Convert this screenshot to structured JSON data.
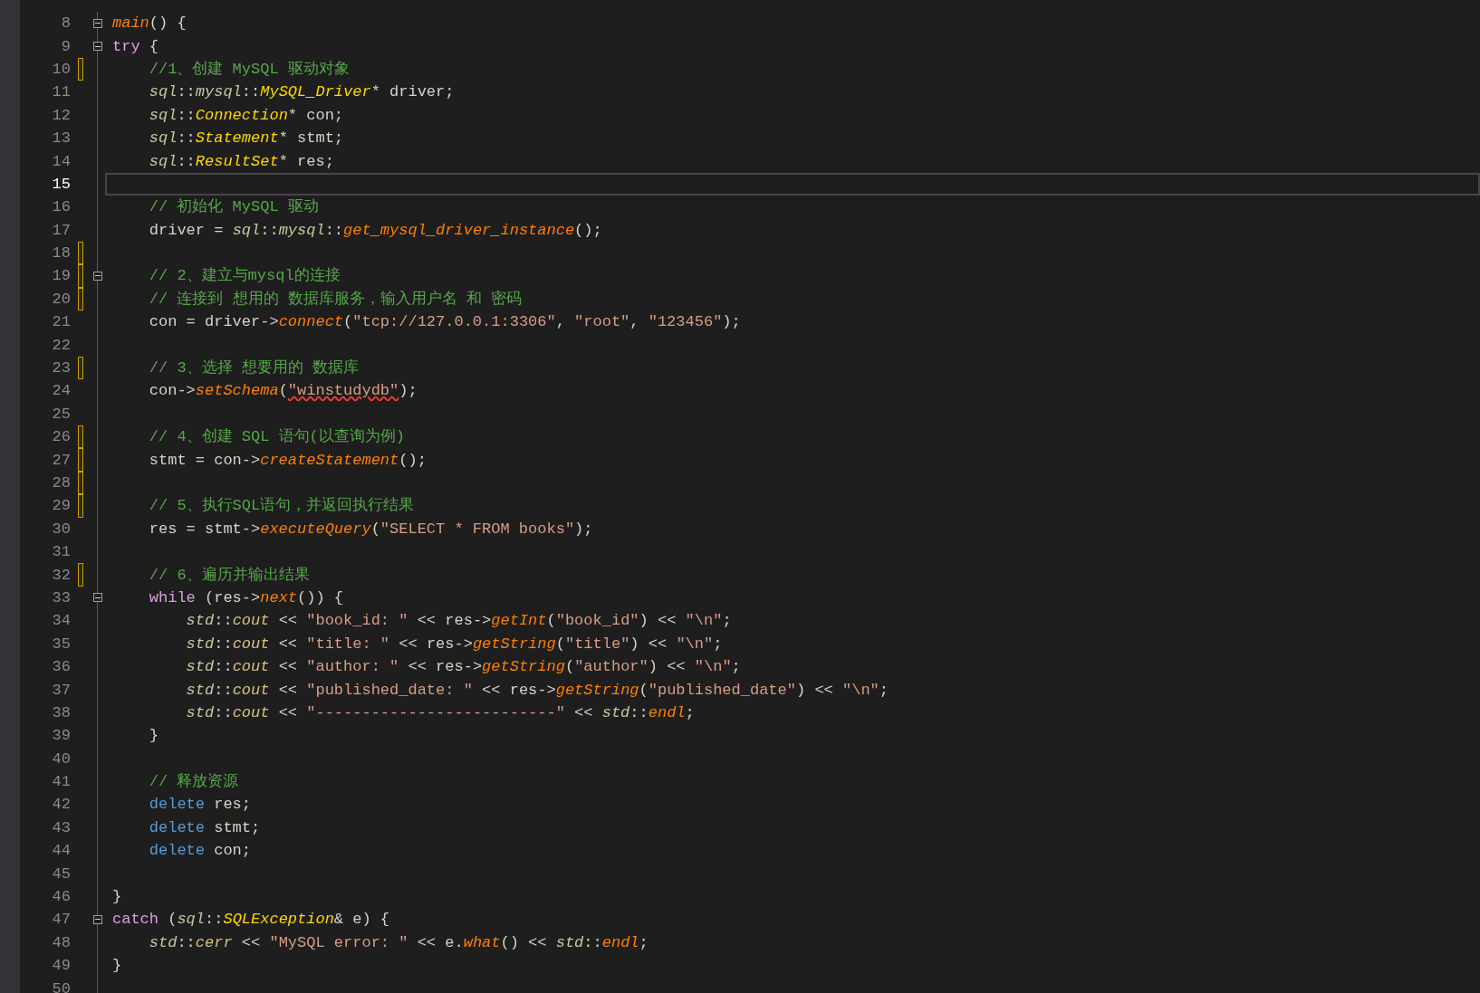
{
  "editor": {
    "lines": [
      {
        "number": "8",
        "fold": true,
        "segments": [
          {
            "kind": "fn",
            "text": "main"
          },
          {
            "kind": "p",
            "text": "() {"
          }
        ]
      },
      {
        "number": "9",
        "fold": true,
        "segments": [
          {
            "kind": "kw",
            "text": "try"
          },
          {
            "kind": "p",
            "text": " {"
          }
        ]
      },
      {
        "number": "10",
        "changed": true,
        "segments": [
          {
            "kind": "cm",
            "text": "    //1、创建 MySQL 驱动对象"
          }
        ]
      },
      {
        "number": "11",
        "segments": [
          {
            "kind": "ns",
            "text": "    sql"
          },
          {
            "kind": "p",
            "text": "::"
          },
          {
            "kind": "ns",
            "text": "mysql"
          },
          {
            "kind": "p",
            "text": "::"
          },
          {
            "kind": "ty",
            "text": "MySQL_Driver"
          },
          {
            "kind": "p",
            "text": "* driver;"
          }
        ]
      },
      {
        "number": "12",
        "segments": [
          {
            "kind": "ns",
            "text": "    sql"
          },
          {
            "kind": "p",
            "text": "::"
          },
          {
            "kind": "ty",
            "text": "Connection"
          },
          {
            "kind": "p",
            "text": "* con;"
          }
        ]
      },
      {
        "number": "13",
        "segments": [
          {
            "kind": "ns",
            "text": "    sql"
          },
          {
            "kind": "p",
            "text": "::"
          },
          {
            "kind": "ty",
            "text": "Statement"
          },
          {
            "kind": "p",
            "text": "* stmt;"
          }
        ]
      },
      {
        "number": "14",
        "segments": [
          {
            "kind": "ns",
            "text": "    sql"
          },
          {
            "kind": "p",
            "text": "::"
          },
          {
            "kind": "ty",
            "text": "ResultSet"
          },
          {
            "kind": "p",
            "text": "* res;"
          }
        ]
      },
      {
        "number": "15",
        "current": true
      },
      {
        "number": "16",
        "segments": [
          {
            "kind": "cm",
            "text": "    // 初始化 MySQL 驱动"
          }
        ]
      },
      {
        "number": "17",
        "segments": [
          {
            "kind": "p",
            "text": "    driver = "
          },
          {
            "kind": "ns",
            "text": "sql"
          },
          {
            "kind": "p",
            "text": "::"
          },
          {
            "kind": "ns",
            "text": "mysql"
          },
          {
            "kind": "p",
            "text": "::"
          },
          {
            "kind": "fn",
            "text": "get_mysql_driver_instance"
          },
          {
            "kind": "p",
            "text": "();"
          }
        ]
      },
      {
        "number": "18",
        "changed": true
      },
      {
        "number": "19",
        "changed": true,
        "fold": true,
        "segments": [
          {
            "kind": "cm",
            "text": "    // 2、建立与mysql的连接"
          }
        ]
      },
      {
        "number": "20",
        "changed": true,
        "segments": [
          {
            "kind": "cm",
            "text": "    // 连接到 想用的 数据库服务，输入用户名 和 密码"
          }
        ]
      },
      {
        "number": "21",
        "segments": [
          {
            "kind": "p",
            "text": "    con = driver->"
          },
          {
            "kind": "fn",
            "text": "connect"
          },
          {
            "kind": "p",
            "text": "("
          },
          {
            "kind": "str",
            "text": "\"tcp://127.0.0.1:3306\""
          },
          {
            "kind": "p",
            "text": ", "
          },
          {
            "kind": "str",
            "text": "\"root\""
          },
          {
            "kind": "p",
            "text": ", "
          },
          {
            "kind": "str",
            "text": "\"123456\""
          },
          {
            "kind": "p",
            "text": ");"
          }
        ]
      },
      {
        "number": "22"
      },
      {
        "number": "23",
        "changed": true,
        "segments": [
          {
            "kind": "cm",
            "text": "    // 3、选择 想要用的 数据库"
          }
        ]
      },
      {
        "number": "24",
        "segments": [
          {
            "kind": "p",
            "text": "    con->"
          },
          {
            "kind": "fn",
            "text": "setSchema"
          },
          {
            "kind": "p",
            "text": "("
          },
          {
            "kind": "str",
            "text": "\"winstudydb\"",
            "error": true
          },
          {
            "kind": "p",
            "text": ");"
          }
        ]
      },
      {
        "number": "25"
      },
      {
        "number": "26",
        "changed": true,
        "segments": [
          {
            "kind": "cm",
            "text": "    // 4、创建 SQL 语句(以查询为例)"
          }
        ]
      },
      {
        "number": "27",
        "changed": true,
        "segments": [
          {
            "kind": "p",
            "text": "    stmt = con->"
          },
          {
            "kind": "fn",
            "text": "createStatement"
          },
          {
            "kind": "p",
            "text": "();"
          }
        ]
      },
      {
        "number": "28",
        "changed": true
      },
      {
        "number": "29",
        "changed": true,
        "segments": [
          {
            "kind": "cm",
            "text": "    // 5、执行SQL语句，并返回执行结果"
          }
        ]
      },
      {
        "number": "30",
        "segments": [
          {
            "kind": "p",
            "text": "    res = stmt->"
          },
          {
            "kind": "fn",
            "text": "executeQuery"
          },
          {
            "kind": "p",
            "text": "("
          },
          {
            "kind": "str",
            "text": "\"SELECT * FROM books\""
          },
          {
            "kind": "p",
            "text": ");"
          }
        ]
      },
      {
        "number": "31"
      },
      {
        "number": "32",
        "changed": true,
        "segments": [
          {
            "kind": "cm",
            "text": "    // 6、遍历并输出结果"
          }
        ]
      },
      {
        "number": "33",
        "fold": true,
        "segments": [
          {
            "kind": "kw",
            "text": "    while"
          },
          {
            "kind": "p",
            "text": " (res->"
          },
          {
            "kind": "fn",
            "text": "next"
          },
          {
            "kind": "p",
            "text": "()) {"
          }
        ]
      },
      {
        "number": "34",
        "segments": [
          {
            "kind": "ns",
            "text": "        std"
          },
          {
            "kind": "p",
            "text": "::"
          },
          {
            "kind": "var",
            "text": "cout"
          },
          {
            "kind": "p",
            "text": " << "
          },
          {
            "kind": "str",
            "text": "\"book_id: \""
          },
          {
            "kind": "p",
            "text": " << res->"
          },
          {
            "kind": "fn",
            "text": "getInt"
          },
          {
            "kind": "p",
            "text": "("
          },
          {
            "kind": "str",
            "text": "\"book_id\""
          },
          {
            "kind": "p",
            "text": ") << "
          },
          {
            "kind": "str",
            "text": "\"\\n\""
          },
          {
            "kind": "p",
            "text": ";"
          }
        ]
      },
      {
        "number": "35",
        "segments": [
          {
            "kind": "ns",
            "text": "        std"
          },
          {
            "kind": "p",
            "text": "::"
          },
          {
            "kind": "var",
            "text": "cout"
          },
          {
            "kind": "p",
            "text": " << "
          },
          {
            "kind": "str",
            "text": "\"title: \""
          },
          {
            "kind": "p",
            "text": " << res->"
          },
          {
            "kind": "fn",
            "text": "getString"
          },
          {
            "kind": "p",
            "text": "("
          },
          {
            "kind": "str",
            "text": "\"title\""
          },
          {
            "kind": "p",
            "text": ") << "
          },
          {
            "kind": "str",
            "text": "\"\\n\""
          },
          {
            "kind": "p",
            "text": ";"
          }
        ]
      },
      {
        "number": "36",
        "segments": [
          {
            "kind": "ns",
            "text": "        std"
          },
          {
            "kind": "p",
            "text": "::"
          },
          {
            "kind": "var",
            "text": "cout"
          },
          {
            "kind": "p",
            "text": " << "
          },
          {
            "kind": "str",
            "text": "\"author: \""
          },
          {
            "kind": "p",
            "text": " << res->"
          },
          {
            "kind": "fn",
            "text": "getString"
          },
          {
            "kind": "p",
            "text": "("
          },
          {
            "kind": "str",
            "text": "\"author\""
          },
          {
            "kind": "p",
            "text": ") << "
          },
          {
            "kind": "str",
            "text": "\"\\n\""
          },
          {
            "kind": "p",
            "text": ";"
          }
        ]
      },
      {
        "number": "37",
        "segments": [
          {
            "kind": "ns",
            "text": "        std"
          },
          {
            "kind": "p",
            "text": "::"
          },
          {
            "kind": "var",
            "text": "cout"
          },
          {
            "kind": "p",
            "text": " << "
          },
          {
            "kind": "str",
            "text": "\"published_date: \""
          },
          {
            "kind": "p",
            "text": " << res->"
          },
          {
            "kind": "fn",
            "text": "getString"
          },
          {
            "kind": "p",
            "text": "("
          },
          {
            "kind": "str",
            "text": "\"published_date\""
          },
          {
            "kind": "p",
            "text": ") << "
          },
          {
            "kind": "str",
            "text": "\"\\n\""
          },
          {
            "kind": "p",
            "text": ";"
          }
        ]
      },
      {
        "number": "38",
        "segments": [
          {
            "kind": "ns",
            "text": "        std"
          },
          {
            "kind": "p",
            "text": "::"
          },
          {
            "kind": "var",
            "text": "cout"
          },
          {
            "kind": "p",
            "text": " << "
          },
          {
            "kind": "str",
            "text": "\"--------------------------\""
          },
          {
            "kind": "p",
            "text": " << "
          },
          {
            "kind": "ns",
            "text": "std"
          },
          {
            "kind": "p",
            "text": "::"
          },
          {
            "kind": "fn",
            "text": "endl"
          },
          {
            "kind": "p",
            "text": ";"
          }
        ]
      },
      {
        "number": "39",
        "segments": [
          {
            "kind": "p",
            "text": "    }"
          }
        ]
      },
      {
        "number": "40"
      },
      {
        "number": "41",
        "segments": [
          {
            "kind": "cm",
            "text": "    // 释放资源"
          }
        ]
      },
      {
        "number": "42",
        "segments": [
          {
            "kind": "kw2",
            "text": "    delete"
          },
          {
            "kind": "p",
            "text": " res;"
          }
        ]
      },
      {
        "number": "43",
        "segments": [
          {
            "kind": "kw2",
            "text": "    delete"
          },
          {
            "kind": "p",
            "text": " stmt;"
          }
        ]
      },
      {
        "number": "44",
        "segments": [
          {
            "kind": "kw2",
            "text": "    delete"
          },
          {
            "kind": "p",
            "text": " con;"
          }
        ]
      },
      {
        "number": "45"
      },
      {
        "number": "46",
        "segments": [
          {
            "kind": "p",
            "text": "}"
          }
        ]
      },
      {
        "number": "47",
        "fold": true,
        "segments": [
          {
            "kind": "kw",
            "text": "catch"
          },
          {
            "kind": "p",
            "text": " ("
          },
          {
            "kind": "ns",
            "text": "sql"
          },
          {
            "kind": "p",
            "text": "::"
          },
          {
            "kind": "ty",
            "text": "SQLException"
          },
          {
            "kind": "p",
            "text": "& e) {"
          }
        ]
      },
      {
        "number": "48",
        "segments": [
          {
            "kind": "ns",
            "text": "    std"
          },
          {
            "kind": "p",
            "text": "::"
          },
          {
            "kind": "var",
            "text": "cerr"
          },
          {
            "kind": "p",
            "text": " << "
          },
          {
            "kind": "str",
            "text": "\"MySQL error: \""
          },
          {
            "kind": "p",
            "text": " << e."
          },
          {
            "kind": "fn",
            "text": "what"
          },
          {
            "kind": "p",
            "text": "() << "
          },
          {
            "kind": "ns",
            "text": "std"
          },
          {
            "kind": "p",
            "text": "::"
          },
          {
            "kind": "fn",
            "text": "endl"
          },
          {
            "kind": "p",
            "text": ";"
          }
        ]
      },
      {
        "number": "49",
        "segments": [
          {
            "kind": "p",
            "text": "}"
          }
        ]
      },
      {
        "number": "50"
      }
    ]
  }
}
